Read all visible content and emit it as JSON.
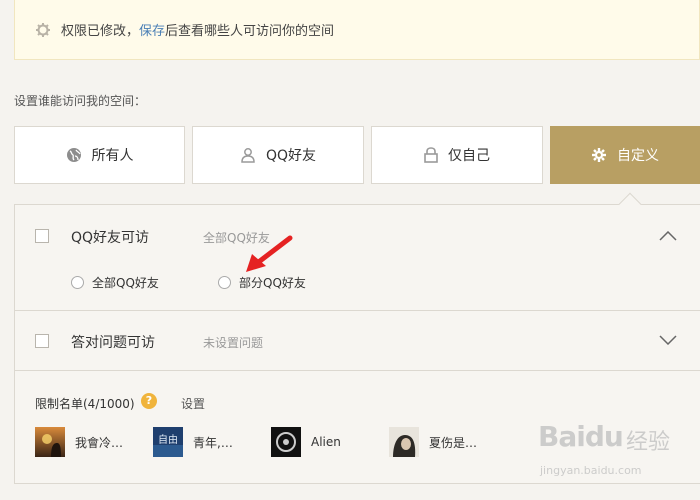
{
  "notice": {
    "prefix": "权限已修改，",
    "link": "保存",
    "suffix": "后查看哪些人可访问你的空间"
  },
  "section_title": "设置谁能访问我的空间：",
  "options": [
    {
      "label": "所有人",
      "icon": "globe-icon"
    },
    {
      "label": "QQ好友",
      "icon": "user-icon"
    },
    {
      "label": "仅自己",
      "icon": "lock-icon"
    },
    {
      "label": "自定义",
      "icon": "gear-icon",
      "active": true
    }
  ],
  "custom": {
    "qq_friends": {
      "label": "QQ好友可访",
      "summary": "全部QQ好友",
      "radio_all": "全部QQ好友",
      "radio_partial": "部分QQ好友"
    },
    "question": {
      "label": "答对问题可访",
      "summary": "未设置问题"
    },
    "limit": {
      "title": "限制名单(4/1000)",
      "help": "?",
      "set": "设置"
    },
    "friends": [
      {
        "name": "我會冷…"
      },
      {
        "name": "青年,…",
        "avatar_text": "自由"
      },
      {
        "name": "Alien"
      },
      {
        "name": "夏伤是…"
      }
    ]
  },
  "watermark": {
    "logo": "Baidu",
    "text": "经验",
    "url": "jingyan.baidu.com"
  },
  "colors": {
    "accent": "#b89f63",
    "notice_bg": "#fffbea",
    "link": "#4a7fb5",
    "help": "#f0b43c",
    "arrow": "#e52222"
  }
}
